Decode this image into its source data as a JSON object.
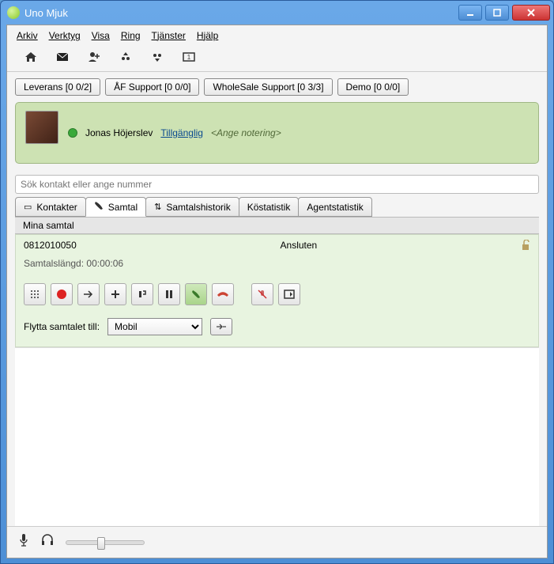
{
  "window": {
    "title": "Uno Mjuk"
  },
  "menu": {
    "items": [
      "Arkiv",
      "Verktyg",
      "Visa",
      "Ring",
      "Tjänster",
      "Hjälp"
    ]
  },
  "queues": [
    {
      "label": "Leverans [0 0/2]"
    },
    {
      "label": "ÅF Support [0 0/0]"
    },
    {
      "label": "WholeSale Support [0 3/3]"
    },
    {
      "label": "Demo [0 0/0]"
    }
  ],
  "profile": {
    "name": "Jonas Höjerslev",
    "status": "Tillgänglig",
    "note": "<Ange notering>"
  },
  "search": {
    "placeholder": "Sök kontakt eller ange nummer"
  },
  "tabs": {
    "contacts": "Kontakter",
    "calls": "Samtal",
    "history": "Samtalshistorik",
    "queuestats": "Köstatistik",
    "agentstats": "Agentstatistik"
  },
  "calls": {
    "section": "Mina samtal",
    "number": "0812010050",
    "status": "Ansluten",
    "duration_label": "Samtalslängd:",
    "duration_value": "00:00:06",
    "move_label": "Flytta samtalet till:",
    "move_options": [
      "Mobil"
    ]
  }
}
